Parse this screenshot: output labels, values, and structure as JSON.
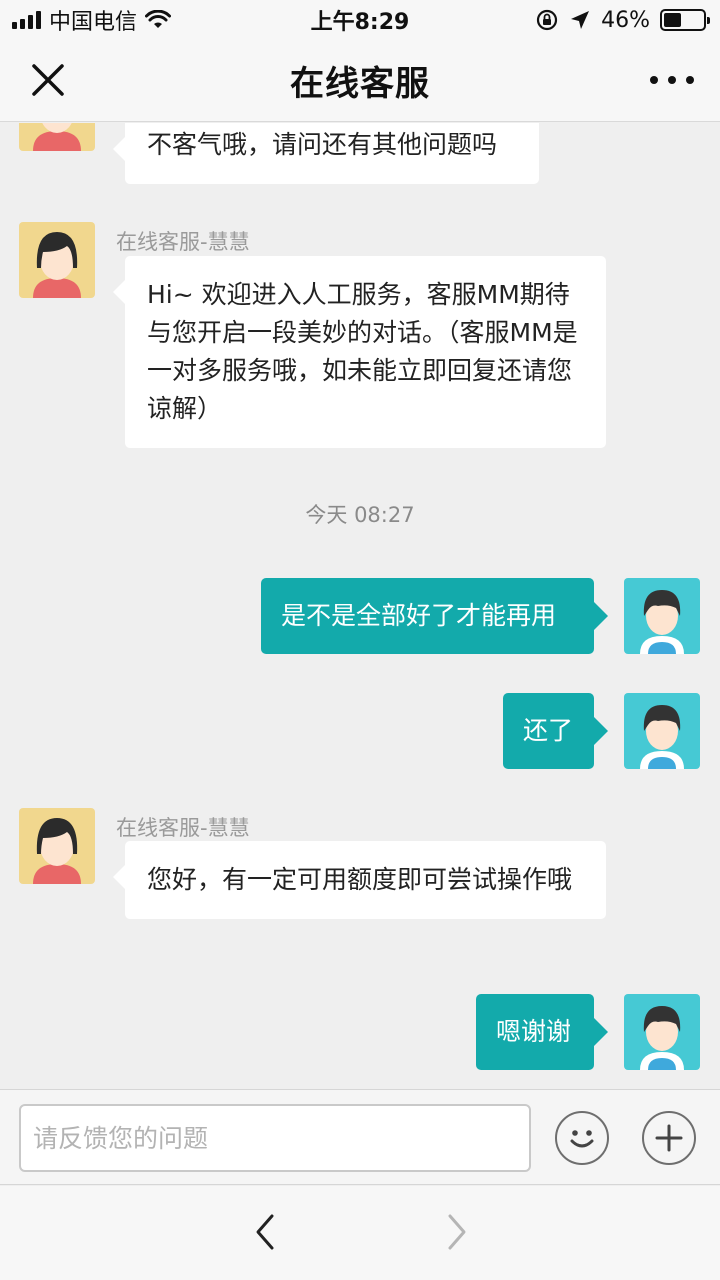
{
  "status_bar": {
    "carrier": "中国电信",
    "time": "上午8:29",
    "battery_text": "46%",
    "battery_level": 0.46
  },
  "header": {
    "title": "在线客服",
    "close_icon": "close-icon",
    "more_icon": "more-icon"
  },
  "messages": [
    {
      "id": "m1",
      "side": "agent",
      "text": "不客气哦，请问还有其他问题吗"
    },
    {
      "id": "m2",
      "side": "agent",
      "sender": "在线客服-慧慧",
      "text": "Hi~ 欢迎进入人工服务，客服MM期待与您开启一段美妙的对话。（客服MM是一对多服务哦，如未能立即回复还请您谅解）"
    },
    {
      "id": "ts",
      "type": "timestamp",
      "text": "今天 08:27"
    },
    {
      "id": "m3",
      "side": "user",
      "text": "是不是全部好了才能再用"
    },
    {
      "id": "m4",
      "side": "user",
      "text": "还了"
    },
    {
      "id": "m5",
      "side": "agent",
      "sender": "在线客服-慧慧",
      "text": "您好，有一定可用额度即可尝试操作哦"
    },
    {
      "id": "m6",
      "side": "user",
      "text": "嗯谢谢"
    }
  ],
  "input": {
    "placeholder": "请反馈您的问题",
    "value": ""
  },
  "colors": {
    "user_bubble": "#13aaab",
    "agent_bubble": "#ffffff",
    "background": "#efefef",
    "agent_avatar_bg": "#f1d78e",
    "user_avatar_bg": "#46c9d4"
  }
}
